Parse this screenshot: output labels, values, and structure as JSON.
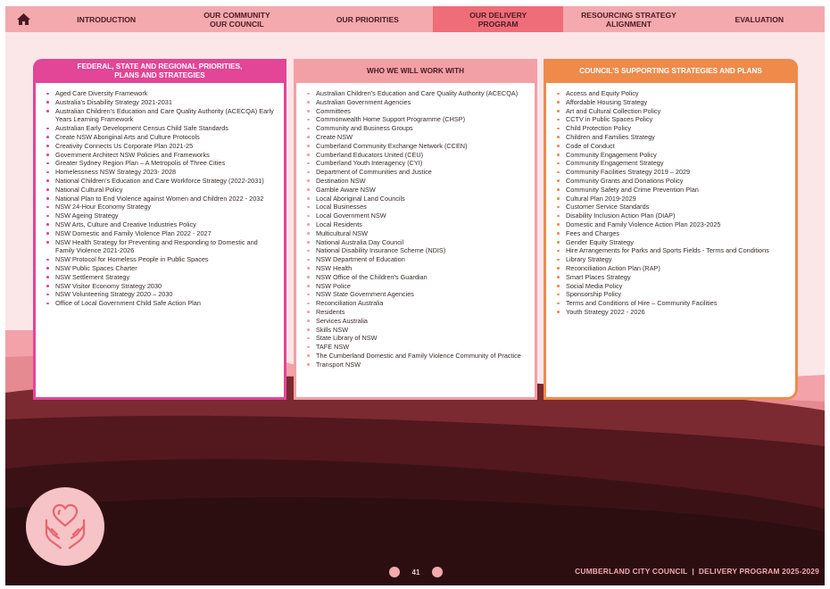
{
  "nav": {
    "home_icon": "home-icon",
    "items": [
      {
        "label": "INTRODUCTION"
      },
      {
        "label": "OUR COMMUNITY\nOUR COUNCIL"
      },
      {
        "label": "OUR PRIORITIES"
      },
      {
        "label": "OUR DELIVERY\nPROGRAM"
      },
      {
        "label": "RESOURCING STRATEGY\nALIGNMENT"
      },
      {
        "label": "EVALUATION"
      }
    ],
    "active_index": 3
  },
  "colors": {
    "nav_bg": "#f3a9ae",
    "nav_active": "#ee6d79",
    "pink": "#e34597",
    "light_pink": "#f2a0a6",
    "orange": "#f08a4b",
    "dark_maroon": "#3a1216"
  },
  "cards": [
    {
      "title": "FEDERAL, STATE AND REGIONAL PRIORITIES,\nPLANS AND STRATEGIES",
      "items": [
        "Aged Care Diversity Framework",
        "Australia’s Disability Strategy 2021-2031",
        "Australian Children’s Education and Care Quality Authority (ACECQA) Early Years Learning Framework",
        "Australian Early Development Census Child Safe Standards",
        "Create NSW Aboriginal Arts and Culture Protocols",
        "Creativity Connects Us Corporate Plan 2021-25",
        "Government Architect NSW Policies and Frameworks",
        "Greater Sydney Region Plan – A Metropolis of Three Cities",
        "Homelessness NSW Strategy 2023- 2028",
        "National Children’s Education and Care Workforce Strategy (2022-2031)",
        "National Cultural Policy",
        "National Plan to End Violence against Women and Children 2022 - 2032",
        "NSW 24-Hour Economy Strategy",
        "NSW Ageing Strategy",
        "NSW Arts, Culture and Creative Industries Policy",
        "NSW Domestic and Family Violence Plan 2022 - 2027",
        "NSW Health Strategy for Preventing and Responding to Domestic and Family Violence 2021-2026",
        "NSW Protocol for Homeless People in Public Spaces",
        "NSW Public Spaces Charter",
        "NSW Settlement Strategy",
        "NSW Visitor Economy Strategy 2030",
        "NSW Volunteering Strategy 2020 – 2030",
        "Office of Local Government Child Safe Action Plan"
      ]
    },
    {
      "title": "WHO WE WILL WORK WITH",
      "items": [
        "Australian Children’s Education and Care Quality Authority (ACECQA)",
        "Australian Government Agencies",
        "Committees",
        "Commonwealth Home Support Programme (CHSP)",
        "Community and Business Groups",
        "Create NSW",
        "Cumberland Community Exchange Network (CCEN)",
        "Cumberland Educators United (CEU)",
        "Cumberland Youth Interagency (CYI)",
        "Department of Communities and Justice",
        "Destination NSW",
        "Gamble Aware NSW",
        "Local Aboriginal Land Councils",
        "Local Businesses",
        "Local Government NSW",
        "Local Residents",
        "Multicultural NSW",
        "National Australia Day Council",
        "National Disability Insurance Scheme (NDIS)",
        "NSW Department of Education",
        "NSW Health",
        "NSW Office of the Children’s Guardian",
        "NSW Police",
        "NSW State Government Agencies",
        "Reconciliation Australia",
        "Residents",
        "Services Australia",
        "Skills NSW",
        "State Library of NSW",
        "TAFE NSW",
        "The Cumberland Domestic and Family Violence Community of Practice",
        "Transport NSW"
      ]
    },
    {
      "title": "COUNCIL’S SUPPORTING STRATEGIES AND PLANS",
      "items": [
        "Access and Equity Policy",
        "Affordable Housing Strategy",
        "Art and Cultural Collection Policy",
        "CCTV in Public Spaces Policy",
        "Child Protection Policy",
        "Children and Families Strategy",
        "Code of Conduct",
        "Community Engagement Policy",
        "Community Engagement Strategy",
        "Community Facilities Strategy 2019 – 2029",
        "Community Grants and Donations Policy",
        "Community Safety and Crime Prevention Plan",
        "Cultural Plan 2019-2029",
        "Customer Service Standards",
        "Disability Inclusion Action Plan (DIAP)",
        "Domestic and Family Violence Action Plan 2023-2025",
        "Fees and Charges",
        "Gender Equity Strategy",
        "Hire Arrangements for Parks and Sports Fields - Terms and Conditions",
        "Library Strategy",
        "Reconciliation Action Plan (RAP)",
        "Smart Places Strategy",
        "Social Media Policy",
        "Sponsorship Policy",
        "Terms and Conditions of Hire – Community Facilities",
        "Youth Strategy 2022 - 2026"
      ]
    }
  ],
  "logo_icon": "heart-hands-icon",
  "footer": {
    "page_number": "41",
    "title": "CUMBERLAND CITY COUNCIL  |  DELIVERY PROGRAM 2025-2029"
  }
}
